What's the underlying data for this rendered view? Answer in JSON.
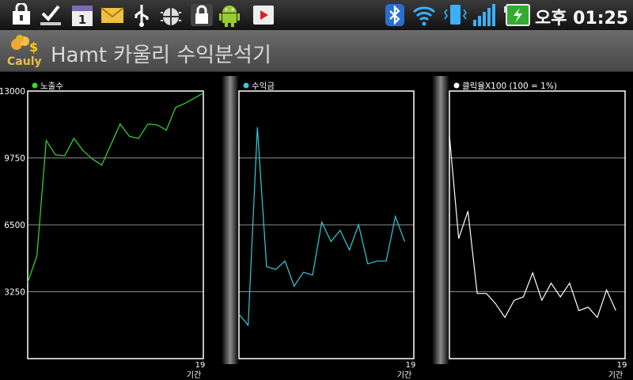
{
  "status_bar": {
    "calendar_day": "1",
    "clock": "오후 01:25",
    "left_icons": [
      "lock-bag-icon",
      "download-done-icon",
      "calendar-icon",
      "mail-icon",
      "usb-icon",
      "android-debug-icon",
      "lock-icon",
      "android-icon",
      "play-store-icon"
    ],
    "right_icons": [
      "bluetooth-icon",
      "wifi-icon",
      "vibrate-icon",
      "signal-icon",
      "battery-charging-icon"
    ]
  },
  "app": {
    "title": "Hamt 카울리 수익분석기",
    "logo_text": "Cauly"
  },
  "colors": {
    "series1": "#33dd33",
    "series2": "#33ccdd",
    "series3": "#ffffff",
    "grid": "#8a8a8a"
  },
  "chart_data": [
    {
      "type": "line",
      "legend": "노출수",
      "x_end_label": "19",
      "xlabel": "기간",
      "yticks": [
        "13000",
        "9750",
        "6500",
        "3250"
      ],
      "ylim": [
        0,
        13000
      ],
      "x": [
        0,
        1,
        2,
        3,
        4,
        5,
        6,
        7,
        8,
        9,
        10,
        11,
        12,
        13,
        14,
        15,
        16,
        17,
        18,
        19
      ],
      "values": [
        3700,
        5000,
        10600,
        9900,
        9850,
        10700,
        10100,
        9700,
        9400,
        10400,
        11400,
        10800,
        10700,
        11400,
        11350,
        11100,
        12200,
        12400,
        12650,
        12900
      ]
    },
    {
      "type": "line",
      "legend": "수익금",
      "x_end_label": "19",
      "xlabel": "기간",
      "yticks": [],
      "x": [
        0,
        1,
        2,
        3,
        4,
        5,
        6,
        7,
        8,
        9,
        10,
        11,
        12,
        13,
        14,
        15,
        16,
        17,
        18,
        19
      ],
      "values": [
        5.6,
        5.2,
        12.3,
        7.3,
        7.2,
        7.5,
        6.6,
        7.1,
        7.0,
        8.9,
        8.2,
        8.6,
        7.9,
        8.8,
        7.4,
        7.5,
        7.5,
        9.1,
        8.2,
        null
      ]
    },
    {
      "type": "line",
      "legend": "클릭율X100 (100 = 1%)",
      "x_end_label": "19",
      "xlabel": "기간",
      "yticks": [],
      "x": [
        0,
        1,
        2,
        3,
        4,
        5,
        6,
        7,
        8,
        9,
        10,
        11,
        12,
        13,
        14,
        15,
        16,
        17,
        18,
        19
      ],
      "values": [
        9.2,
        6.2,
        7.0,
        4.6,
        4.6,
        4.3,
        3.9,
        4.4,
        4.5,
        5.2,
        4.4,
        4.9,
        4.5,
        4.9,
        4.1,
        4.2,
        3.9,
        4.7,
        4.1,
        null
      ]
    }
  ]
}
